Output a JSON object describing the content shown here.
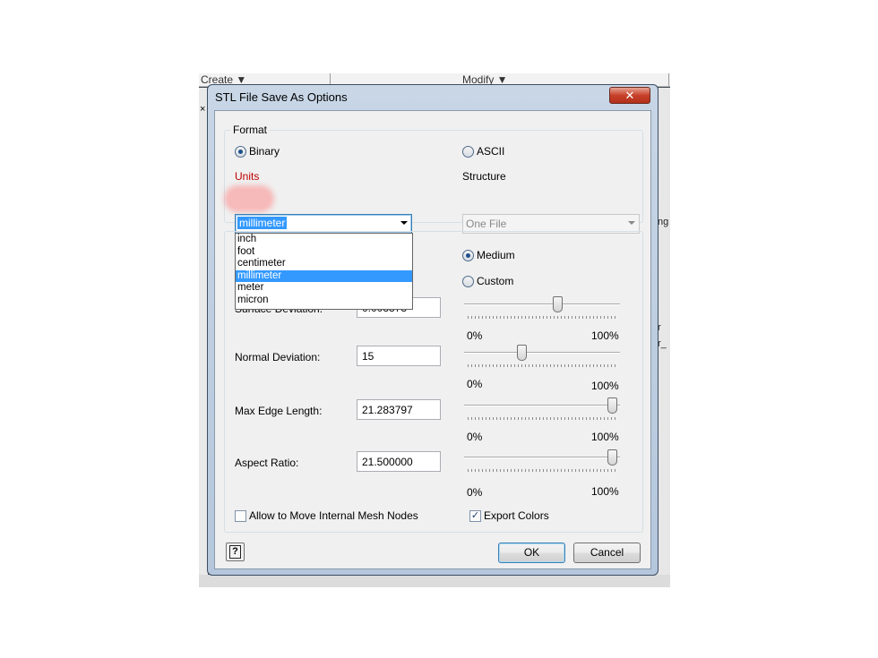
{
  "background_app": {
    "menu_create": "Create ▼",
    "menu_modify": "Modify ▼",
    "right_fragments": [
      "ng",
      "r",
      "r_"
    ],
    "left_close_glyph": "×"
  },
  "dialog": {
    "title": "STL File Save As Options",
    "close_glyph": "✕",
    "format": {
      "group_title": "Format",
      "binary_label": "Binary",
      "ascii_label": "ASCII",
      "selected": "Binary",
      "units_label": "Units",
      "units_value": "millimeter",
      "structure_label": "Structure",
      "structure_value": "One File",
      "units_options": [
        "inch",
        "foot",
        "centimeter",
        "millimeter",
        "meter",
        "micron"
      ]
    },
    "resolution": {
      "medium_label": "Medium",
      "custom_label": "Custom",
      "selected": "Medium",
      "rows": [
        {
          "label": "Surface Deviation:",
          "value": "0.003373",
          "slider_fraction": 0.6,
          "min_label": "0%",
          "max_label": "100%"
        },
        {
          "label": "Normal Deviation:",
          "value": "15",
          "slider_fraction": 0.36,
          "min_label": "0%",
          "max_label": "100%"
        },
        {
          "label": "Max Edge Length:",
          "value": "21.283797",
          "slider_fraction": 0.97,
          "min_label": "0%",
          "max_label": "100%"
        },
        {
          "label": "Aspect Ratio:",
          "value": "21.500000",
          "slider_fraction": 0.97,
          "min_label": "0%",
          "max_label": "100%"
        }
      ]
    },
    "options": {
      "move_internal_label": "Allow to Move Internal Mesh Nodes",
      "move_internal_checked": false,
      "export_colors_label": "Export Colors",
      "export_colors_checked": true
    },
    "buttons": {
      "help": "?",
      "ok": "OK",
      "cancel": "Cancel"
    }
  },
  "colors": {
    "selection": "#3399ff",
    "units_highlight": "#ff7878",
    "units_label": "#c00000"
  }
}
